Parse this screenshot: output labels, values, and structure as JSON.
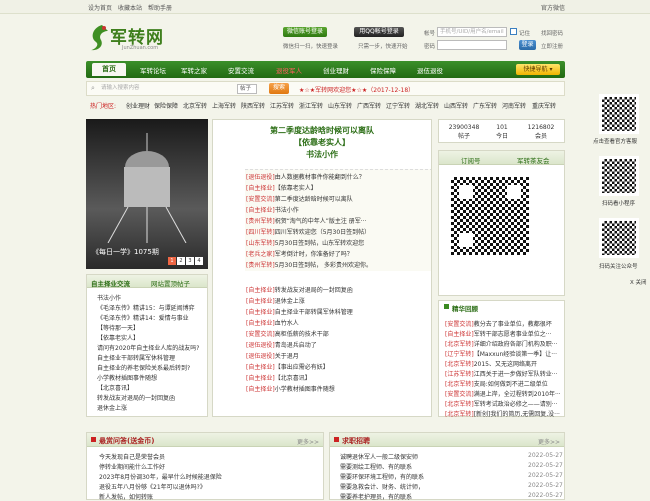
{
  "topbar": {
    "links": [
      "设为首页",
      "收藏本站",
      "帮助手册"
    ],
    "right": "官方微信"
  },
  "logo": {
    "text": "军转网",
    "sub": "JunZhuan.com"
  },
  "login": {
    "wechat_label": "微信账号登录",
    "wechat_hint": "微信扫一扫，快速登录",
    "qq_label": "用QQ帐号登录",
    "qq_hint": "只需一步，快速开始",
    "account_label": "帐号",
    "account_placeholder": "手机号/UID/用户名/email",
    "remember": "记住",
    "register": "注册",
    "password_label": "密码",
    "login_btn": "登录",
    "find_pwd": "找回密码",
    "reg_now": "立即注册"
  },
  "nav": {
    "home": "首页",
    "items": [
      "军转论坛",
      "军转之家",
      "安置交流",
      "退役军人",
      "创业理财",
      "保险保障",
      "退伍退役"
    ],
    "quick": "快捷导航"
  },
  "search": {
    "placeholder": "请输入搜索内容",
    "select": "帖子",
    "btn": "搜索",
    "ticker": "★☆★军转网欢迎您★☆★（2017-12-18）"
  },
  "hot": {
    "label": "热门地区:",
    "items": [
      "创业理财",
      "保险保障",
      "北京军转",
      "上海军转",
      "陕西军转",
      "江苏军转",
      "浙江军转",
      "山东军转",
      "广西军转",
      "辽宁军转",
      "湖北军转",
      "山西军转",
      "广东军转",
      "河南军转",
      "重庆军转"
    ]
  },
  "slider": {
    "caption": "《每日一学》1075期",
    "pages": [
      "1",
      "2",
      "3",
      "4"
    ]
  },
  "feature": {
    "title1": "第二季度达龄晗时候可以离队",
    "title2": "【依靠老实人】",
    "title3": "书法小作",
    "items": [
      [
        "[退伍退役]",
        "由人数据教材事件你能翻到什么？"
      ],
      [
        "[自主择业]",
        "【依靠老实人】"
      ],
      [
        "[安置交流]",
        "第二季度达龄晗时候可以离队"
      ],
      [
        "[自主择业]",
        "书法小作"
      ],
      [
        "[贵州军转]",
        "祝贺“淘气的中年人”版主注 册军···"
      ],
      [
        "[四川军转]",
        "四川军转欢迎您（5月30日签到帖）"
      ],
      [
        "[山东军转]",
        "5月30日签到帖，山东军转欢迎您"
      ],
      [
        "[老兵之家]",
        "军考倒计时，你准备好了吗？"
      ],
      [
        "[贵州军转]",
        "5月30日签到帖，  多彩贵州欢迎你。"
      ]
    ],
    "items2": [
      [
        "[自主择业]",
        "转发战友对退局的一封回复函"
      ],
      [
        "[自主择业]",
        "退休金上涨"
      ],
      [
        "[自主择业]",
        "自主择业干部转属军休科管理"
      ],
      [
        "[自主择业]",
        "血竹水人"
      ],
      [
        "[安置交流]",
        "高柜低薪的技术干部"
      ],
      [
        "[退伍退役]",
        "青岛退兵启动了"
      ],
      [
        "[退伍退役]",
        "关于退月"
      ],
      [
        "[自主择业]",
        "【事出应需必有妖】"
      ],
      [
        "[自主择业]",
        "【北京喜讯】"
      ],
      [
        "[自主择业]",
        "小学教材插图事件随想"
      ]
    ]
  },
  "stats": [
    {
      "num": "23900348",
      "label": "帖子"
    },
    {
      "num": "101",
      "label": "今日"
    },
    {
      "num": "1216802",
      "label": "会员"
    }
  ],
  "qrbox": {
    "tabs": [
      "订阅号",
      "军转茶友会"
    ]
  },
  "left_tabs": {
    "tabs": [
      "自主择业交流",
      "网站置顶帖子"
    ],
    "items": [
      "书法小作",
      "《毛泽东传》精讲15：与谭延闿博弈",
      "《毛泽东传》精讲14：爱情与事业",
      "【等待那一天】",
      "【依靠老实人】",
      "请问有2020年自主择业人库的战友吗?",
      "自主择业干部转属军休科管理",
      "自主择业的养老保险关系最后转到?",
      "小学教材插图事件随想",
      "【北京喜讯】",
      "转发战友对退局的一封回复函",
      "退休金上涨"
    ]
  },
  "right_qr": [
    {
      "label": "点击查看官方客服"
    },
    {
      "label": "扫码看小程序"
    },
    {
      "label": "扫码关注公众号"
    }
  ],
  "side_close": "X 关闭",
  "essence": {
    "title": "精华回顾",
    "items": [
      [
        "[安置交流]",
        "教分去了事业单位，教都很坏"
      ],
      [
        "[自主择业]",
        "军转干部志愿者事业单位之···"
      ],
      [
        "[北京军转]",
        "详细介绍政府各部门机构及职···"
      ],
      [
        "[辽宁军转]",
        "【Maxxun经验谈第一季】让···"
      ],
      [
        "[北京军转]",
        "2015、又无这网络离开"
      ],
      [
        "[江苏军转]",
        "江西关于进一步做好军队转业···"
      ],
      [
        "[北京军转]",
        "支局:如何做到不进二级单位"
      ],
      [
        "[安置交流]",
        "满退上岸，全过程转到2010年···"
      ],
      [
        "[北京军转]",
        "军转考试政治必修之——请别···"
      ],
      [
        "[北京军转]",
        "[新创]我们的简历,无需回复,没···"
      ]
    ]
  },
  "qa": {
    "title": "悬赏问答(送金币)",
    "more": "更多>>",
    "items": [
      "今天发现自己是荣誉会员",
      "停转业期间能什么工作好",
      "2023年8月份调30年，最早什么时候能退保险",
      "退役五年八月份够《21年可以退休吗?》",
      "新人发帖，如何转账"
    ]
  },
  "jobs": {
    "title": "求职招聘",
    "more": "更多>>",
    "items": [
      [
        "诚聘退休军人一般二级保安师",
        "2022-05-27"
      ],
      [
        "需要测绘工程师、有的联系",
        "2022-05-27"
      ],
      [
        "需要环保环境工程师，有的联系",
        "2022-05-27"
      ],
      [
        "需要急救会计、财务、统计师，",
        "2022-05-27"
      ],
      [
        "需要养老护理员，有的联系",
        "2022-05-27"
      ]
    ]
  }
}
